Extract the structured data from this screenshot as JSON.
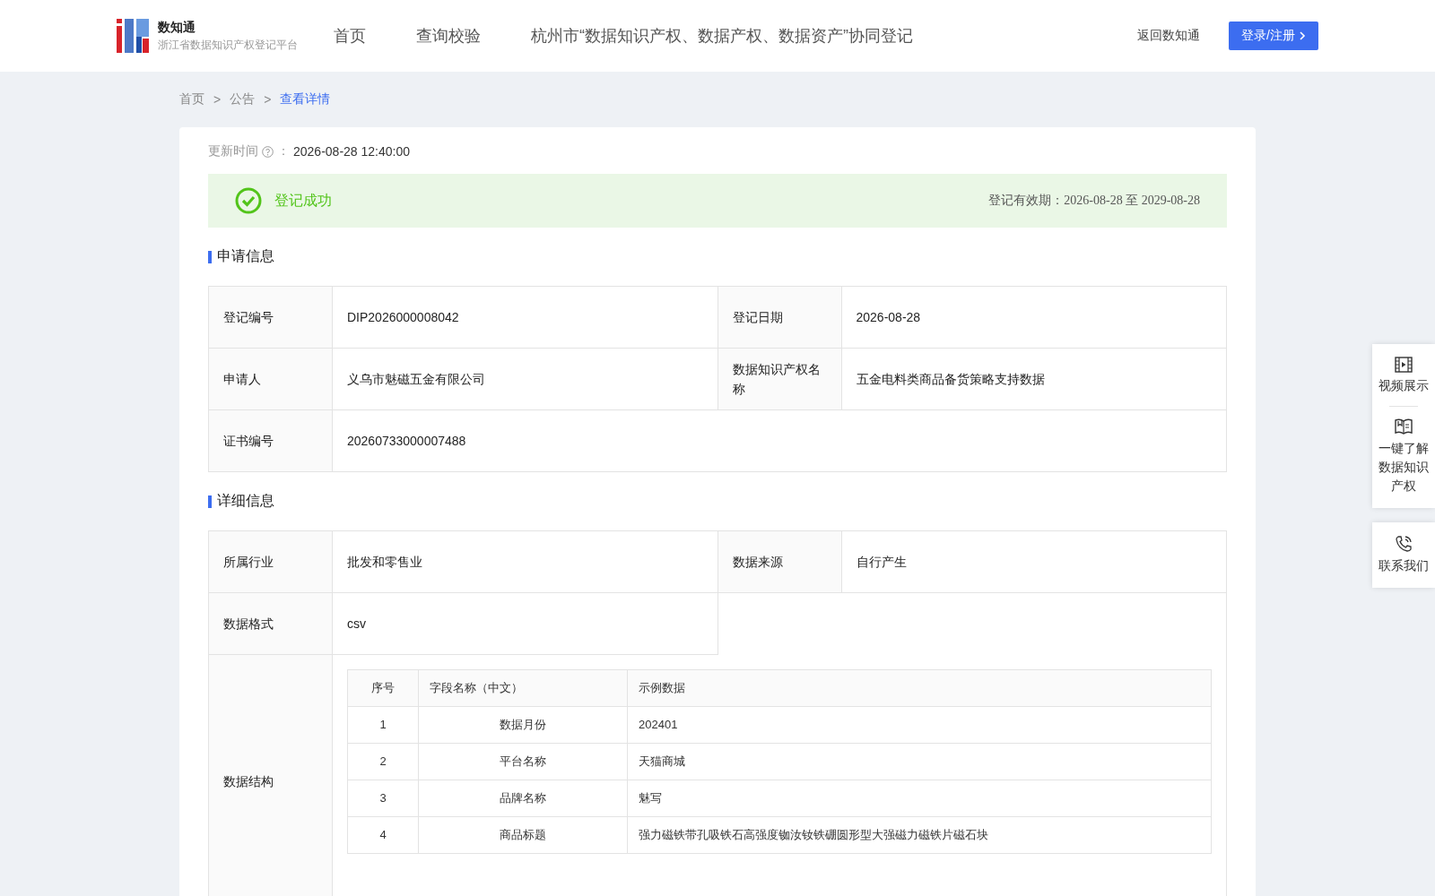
{
  "header": {
    "logo_title": "数知通",
    "logo_subtitle": "浙江省数据知识产权登记平台",
    "nav": [
      {
        "label": "首页",
        "selected": false
      },
      {
        "label": "查询校验",
        "selected": false
      },
      {
        "label": "杭州市“数据知识产权、数据产权、数据资产”协同登记",
        "selected": false
      }
    ],
    "back_link": "返回数知通",
    "login_button": "登录/注册"
  },
  "breadcrumb": {
    "separator": ">",
    "items": [
      {
        "label": "首页",
        "selected": false
      },
      {
        "label": "公告",
        "selected": false
      },
      {
        "label": "查看详情",
        "selected": true
      }
    ]
  },
  "update_time": {
    "label": "更新时间",
    "separator": "：",
    "value": "2026-08-28 12:40:00"
  },
  "status": {
    "text": "登记成功",
    "validity": "登记有效期：2026-08-28 至 2029-08-28"
  },
  "sections": [
    {
      "title": "申请信息",
      "rows": [
        {
          "kind": "pair",
          "cells": [
            {
              "label": "登记编号",
              "value": "DIP2026000008042"
            },
            {
              "label": "登记日期",
              "value": "2026-08-28"
            }
          ]
        },
        {
          "kind": "pair",
          "cells": [
            {
              "label": "申请人",
              "value": "义乌市魅磁五金有限公司"
            },
            {
              "label": "数据知识产权名称",
              "value": "五金电料类商品备货策略支持数据"
            }
          ]
        },
        {
          "kind": "wide",
          "cells": [
            {
              "label": "证书编号",
              "value": "20260733000007488"
            }
          ]
        }
      ]
    },
    {
      "title": "详细信息",
      "rows": [
        {
          "kind": "pair",
          "cells": [
            {
              "label": "所属行业",
              "value": "批发和零售业"
            },
            {
              "label": "数据来源",
              "value": "自行产生"
            }
          ]
        },
        {
          "kind": "half",
          "cells": [
            {
              "label": "数据格式",
              "value": "csv"
            }
          ]
        },
        {
          "kind": "structure",
          "label": "数据结构",
          "columns": [
            "序号",
            "字段名称（中文）",
            "示例数据"
          ],
          "rows": [
            [
              "1",
              "数据月份",
              "202401"
            ],
            [
              "2",
              "平台名称",
              "天猫商城"
            ],
            [
              "3",
              "品牌名称",
              "魅写"
            ],
            [
              "4",
              "商品标题",
              "强力磁铁带孔吸铁石高强度铷汝钕铁硼圆形型大强磁力磁铁片磁石块"
            ]
          ]
        }
      ]
    }
  ],
  "side_menu": [
    {
      "kind": "video",
      "label": "视频展示"
    },
    {
      "kind": "book",
      "label": "一键了解数据知识产权"
    },
    {
      "kind": "phone",
      "label": "联系我们"
    }
  ]
}
